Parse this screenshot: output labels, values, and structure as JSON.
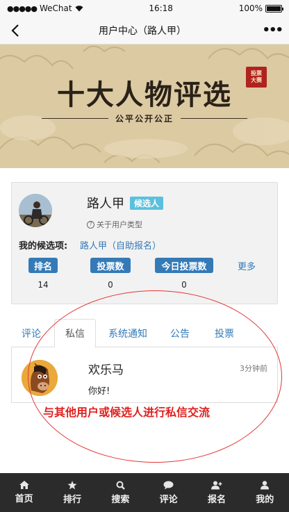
{
  "status_bar": {
    "carrier": "WeChat",
    "time": "16:18",
    "battery": "100%"
  },
  "nav": {
    "title": "用户中心（路人甲）"
  },
  "banner": {
    "title": "十大人物评选",
    "subtitle": "公平公开公正",
    "seal_line1": "投票",
    "seal_line2": "大赛"
  },
  "profile": {
    "name": "路人甲",
    "badge": "候选人",
    "user_type_link": "关于用户类型",
    "entry_label": "我的候选项:",
    "entry_value": "路人甲（自助报名）",
    "stats": [
      {
        "label": "排名",
        "value": "14"
      },
      {
        "label": "投票数",
        "value": "0"
      },
      {
        "label": "今日投票数",
        "value": "0"
      }
    ],
    "more": "更多"
  },
  "tabs": [
    {
      "label": "评论",
      "active": false
    },
    {
      "label": "私信",
      "active": true
    },
    {
      "label": "系统通知",
      "active": false
    },
    {
      "label": "公告",
      "active": false
    },
    {
      "label": "投票",
      "active": false
    }
  ],
  "message": {
    "sender": "欢乐马",
    "time": "3分钟前",
    "text": "你好!"
  },
  "annotation": {
    "text": "与其他用户或候选人进行私信交流",
    "color": "#e0201e"
  },
  "bottom_nav": [
    {
      "label": "首页",
      "icon": "home-icon"
    },
    {
      "label": "排行",
      "icon": "star-icon"
    },
    {
      "label": "搜索",
      "icon": "search-icon"
    },
    {
      "label": "评论",
      "icon": "comment-icon"
    },
    {
      "label": "报名",
      "icon": "add-user-icon"
    },
    {
      "label": "我的",
      "icon": "user-icon"
    }
  ],
  "colors": {
    "link": "#337ab7",
    "badge_info": "#5bc0de",
    "bottom_bar": "#2b2b2b"
  }
}
